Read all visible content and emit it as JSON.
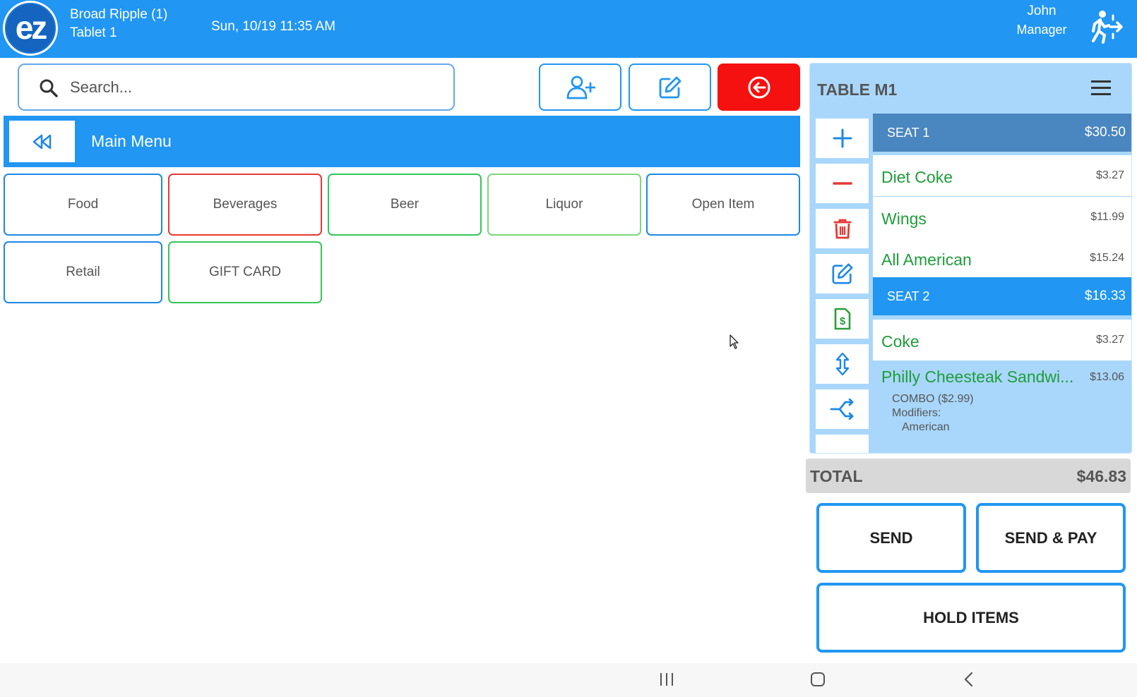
{
  "header": {
    "logo_text": "ez",
    "location": "Broad Ripple (1)",
    "device": "Tablet 1",
    "datetime": "Sun, 10/19 11:35 AM",
    "user_name": "John",
    "user_role": "Manager",
    "logout_icon": "running-exit-icon"
  },
  "search": {
    "placeholder": "Search...",
    "value": "",
    "icon": "search-icon"
  },
  "toolbar": {
    "add_user_icon": "add-user-icon",
    "edit_icon": "edit-icon",
    "back_icon": "circle-arrow-left-icon"
  },
  "menu_bar": {
    "title": "Main Menu",
    "back_icon": "rewind-icon"
  },
  "categories": [
    {
      "label": "Food",
      "color": "#1e88e5"
    },
    {
      "label": "Beverages",
      "color": "#e53935"
    },
    {
      "label": "Beer",
      "color": "#34c759"
    },
    {
      "label": "Liquor",
      "color": "#7dd87a"
    },
    {
      "label": "Open Item",
      "color": "#1e88e5"
    },
    {
      "label": "Retail",
      "color": "#1e88e5"
    },
    {
      "label": "GIFT CARD",
      "color": "#34c759"
    }
  ],
  "order": {
    "title": "TABLE M1",
    "menu_icon": "hamburger-icon",
    "side_actions": [
      "plus-icon",
      "minus-icon",
      "trash-icon",
      "edit-icon",
      "dollar-document-icon",
      "move-vertical-icon",
      "split-icon"
    ],
    "seats": [
      {
        "label": "SEAT 1",
        "total": "$30.50",
        "color": "#4a86c0",
        "items": [
          {
            "name": "Diet Coke",
            "price": "$3.27"
          },
          {
            "name": "Wings",
            "price": "$11.99"
          },
          {
            "name": "All American",
            "price": "$15.24"
          }
        ]
      },
      {
        "label": "SEAT 2",
        "total": "$16.33",
        "color": "#2196f3",
        "items": [
          {
            "name": "Coke",
            "price": "$3.27"
          },
          {
            "name": "Philly Cheesteak Sandwi...",
            "price": "$13.06",
            "combo": "COMBO  ($2.99)",
            "modifiers_label": "Modifiers:",
            "modifier": "American"
          }
        ]
      }
    ]
  },
  "total": {
    "label": "TOTAL",
    "value": "$46.83"
  },
  "actions": {
    "send": "SEND",
    "send_pay": "SEND & PAY",
    "hold": "HOLD ITEMS"
  },
  "navbar": {
    "icons": [
      "recent-apps-icon",
      "home-icon",
      "back-icon"
    ]
  },
  "colors": {
    "primary": "#2196f3",
    "danger": "#f5110f",
    "item_green": "#1f9d3a",
    "panel_bg": "#a9d7fb"
  }
}
